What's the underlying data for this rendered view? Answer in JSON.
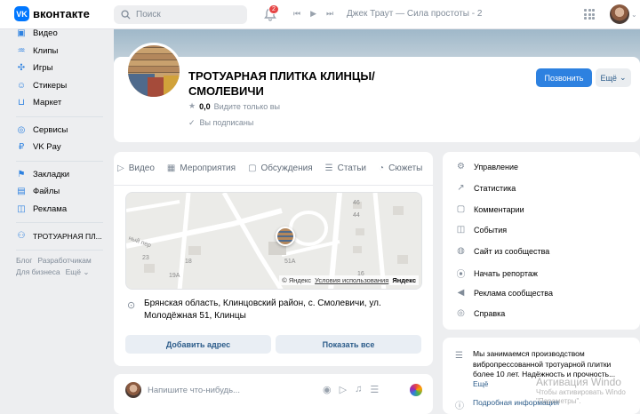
{
  "topbar": {
    "logo_text": "вконтакте",
    "search_placeholder": "Поиск",
    "notifications_count": "2",
    "now_playing": "Джек Траут — Сила простоты - 2"
  },
  "sidebar": {
    "items": [
      {
        "label": "Видео",
        "icon": "video-icon"
      },
      {
        "label": "Клипы",
        "icon": "clips-icon"
      },
      {
        "label": "Игры",
        "icon": "games-icon"
      },
      {
        "label": "Стикеры",
        "icon": "stickers-icon"
      },
      {
        "label": "Маркет",
        "icon": "market-icon"
      }
    ],
    "items2": [
      {
        "label": "Сервисы",
        "icon": "services-icon"
      },
      {
        "label": "VK Pay",
        "icon": "vkpay-icon"
      }
    ],
    "items3": [
      {
        "label": "Закладки",
        "icon": "bookmarks-icon"
      },
      {
        "label": "Файлы",
        "icon": "files-icon"
      },
      {
        "label": "Реклама",
        "icon": "ads-icon"
      }
    ],
    "group_item": "ТРОТУАРНАЯ ПЛ...",
    "footer": [
      "Блог",
      "Разработчикам",
      "Для бизнеса",
      "Ещё ⌄"
    ]
  },
  "group": {
    "name_line1": "ТРОТУАРНАЯ ПЛИТКА КЛИНЦЫ/",
    "name_line2": "СМОЛЕВИЧИ",
    "rating": "0,0",
    "rating_note": "Видите только вы",
    "subscribed": "Вы подписаны",
    "subscribe_btn": "Позвонить",
    "more_btn": "Ещё"
  },
  "tabs": [
    "Видео",
    "Мероприятия",
    "Обсуждения",
    "Статьи",
    "Сюжеты"
  ],
  "map": {
    "labels": [
      "46",
      "44",
      "23",
      "18",
      "19А",
      "51А",
      "16",
      "ный пер"
    ],
    "attribution_link": "Условия использования",
    "attribution_prefix": "© Яндекс",
    "brand": "Яндекс"
  },
  "address": {
    "text": "Брянская область, Клинцовский район, с. Смолевичи, ул. Молодёжная 51, Клинцы",
    "add_btn": "Добавить адрес",
    "show_all_btn": "Показать все"
  },
  "post": {
    "placeholder": "Напишите что-нибудь..."
  },
  "menu": [
    {
      "label": "Управление",
      "icon": "gear-icon"
    },
    {
      "label": "Статистика",
      "icon": "chart-icon"
    },
    {
      "label": "Комментарии",
      "icon": "comment-icon"
    },
    {
      "label": "События",
      "icon": "events-icon"
    },
    {
      "label": "Сайт из сообщества",
      "icon": "globe-icon"
    },
    {
      "label": "Начать репортаж",
      "icon": "broadcast-icon"
    },
    {
      "label": "Реклама сообщества",
      "icon": "megaphone-icon"
    },
    {
      "label": "Справка",
      "icon": "help-icon"
    }
  ],
  "description": {
    "text": "Мы занимаемся производством вибропрессованной тротуарной плитки более 10 лет. Надёжность и прочность...",
    "more": "Ещё",
    "details": "Подробная информация"
  },
  "watermark": {
    "line1": "Активация Windo",
    "line2": "Чтобы активировать Windo",
    "line3": "\"Параметры\"."
  }
}
